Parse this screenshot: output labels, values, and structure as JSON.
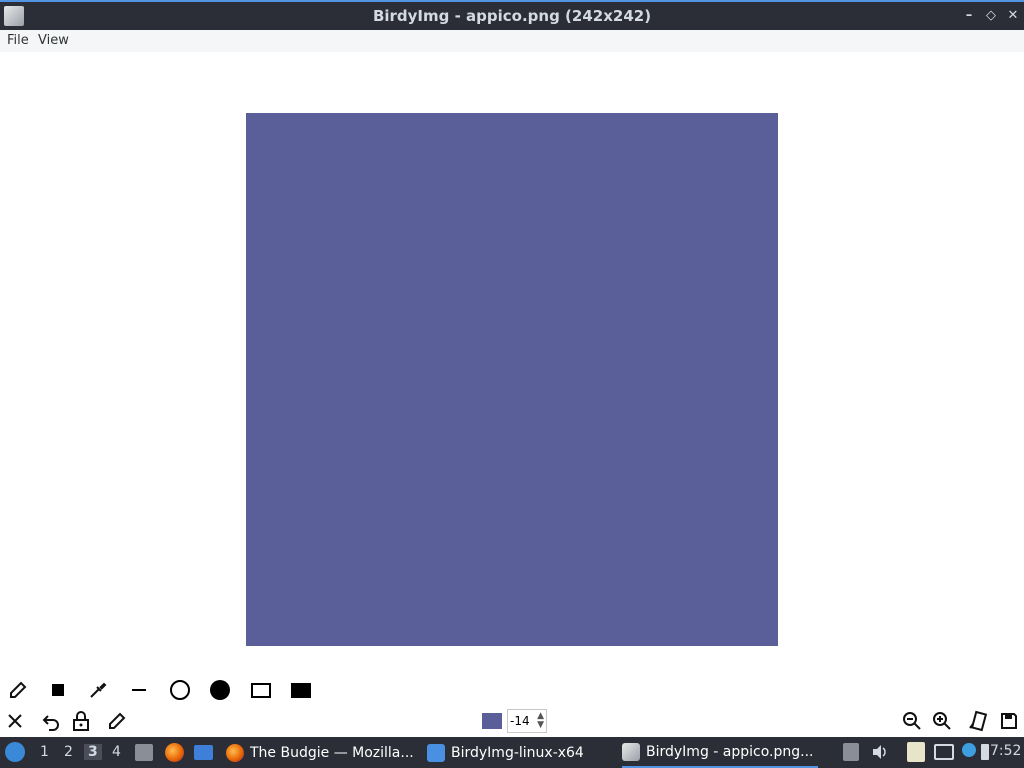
{
  "window": {
    "title": "BirdyImg - appico.png (242x242)",
    "minimize_glyph": "–",
    "maximize_glyph": "◇",
    "close_glyph": "✕"
  },
  "menu": {
    "file": "File",
    "view": "View"
  },
  "image": {
    "fill_color": "#5a5f9a"
  },
  "toolbar": {
    "current_color": "#5a5f9a",
    "size_value": "-14"
  },
  "taskbar": {
    "workspaces": [
      "1",
      "2",
      "3",
      "4"
    ],
    "active_workspace": "3",
    "tasks": [
      {
        "label": "The Budgie — Mozilla..."
      },
      {
        "label": "BirdyImg-linux-x64"
      },
      {
        "label": "BirdyImg - appico.png..."
      }
    ],
    "clock": "7:52"
  },
  "colors": {
    "accent": "#5294e2",
    "panel_bg": "#2b2e37"
  }
}
